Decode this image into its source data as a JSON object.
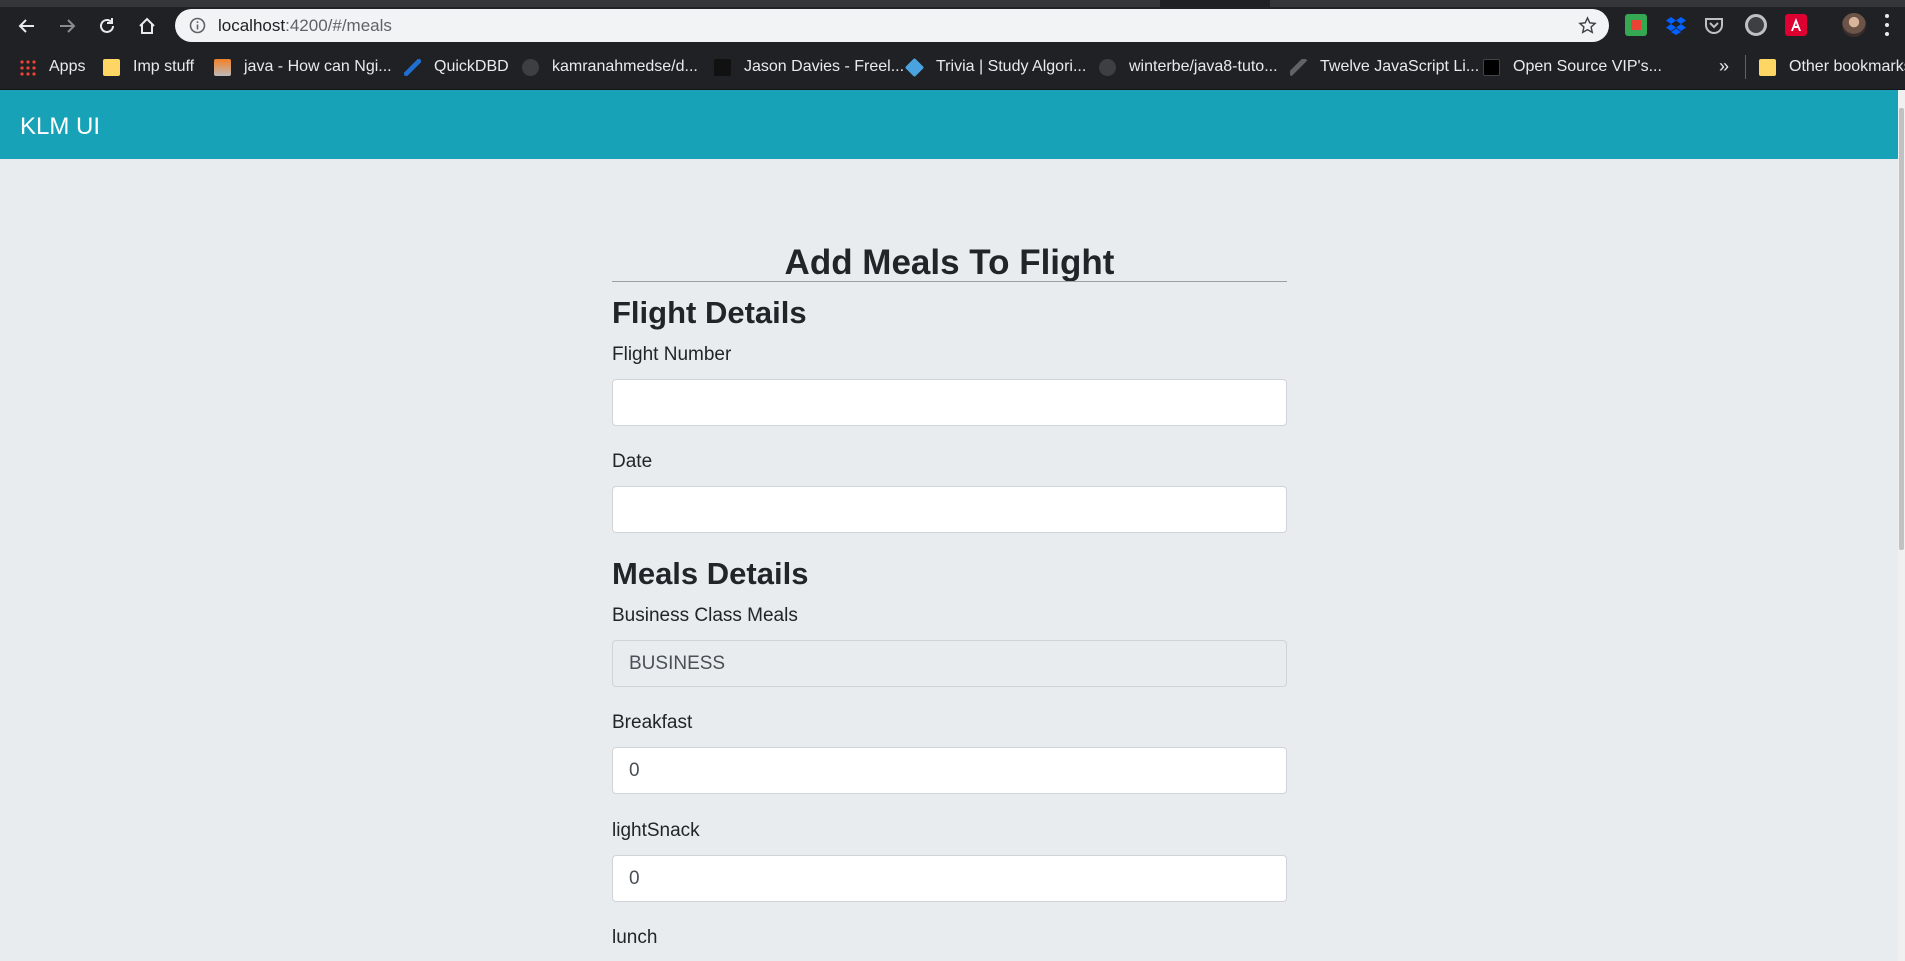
{
  "browser": {
    "url_host": "localhost",
    "url_path": ":4200/#/meals",
    "bookmarks": [
      {
        "label": "Apps",
        "icon": "apps-grid-icon",
        "color": "#ea4335"
      },
      {
        "label": "Imp stuff",
        "icon": "folder-icon",
        "color": "#fdd663"
      },
      {
        "label": "java - How can Ngi...",
        "icon": "stackoverflow-icon",
        "color": "#f48024"
      },
      {
        "label": "QuickDBD",
        "icon": "quickdbd-icon",
        "color": "#1f6fd0"
      },
      {
        "label": "kamranahmedse/d...",
        "icon": "github-icon",
        "color": "#3c4043"
      },
      {
        "label": "Jason Davies - Freel...",
        "icon": "jason-davies-icon",
        "color": "#111111"
      },
      {
        "label": "Trivia | Study Algori...",
        "icon": "trivia-icon",
        "color": "#4aa3df"
      },
      {
        "label": "winterbe/java8-tuto...",
        "icon": "github-icon",
        "color": "#3c4043"
      },
      {
        "label": "Twelve JavaScript Li...",
        "icon": "sitepoint-icon",
        "color": "#5f6368"
      },
      {
        "label": "Open Source VIP's...",
        "icon": "medium-icon",
        "color": "#000000"
      }
    ],
    "overflow_label": "»",
    "other_bookmarks": "Other bookmarks"
  },
  "app": {
    "brand": "KLM UI",
    "nav_color": "#17a2b8"
  },
  "form": {
    "title": "Add Meals To Flight",
    "flight_section": "Flight Details",
    "flight_number_label": "Flight Number",
    "flight_number_value": "",
    "date_label": "Date",
    "date_value": "",
    "meals_section": "Meals Details",
    "business_label": "Business Class Meals",
    "business_value": "BUSINESS",
    "breakfast_label": "Breakfast",
    "breakfast_value": "0",
    "light_snack_label": "lightSnack",
    "light_snack_value": "0",
    "lunch_label": "lunch"
  }
}
